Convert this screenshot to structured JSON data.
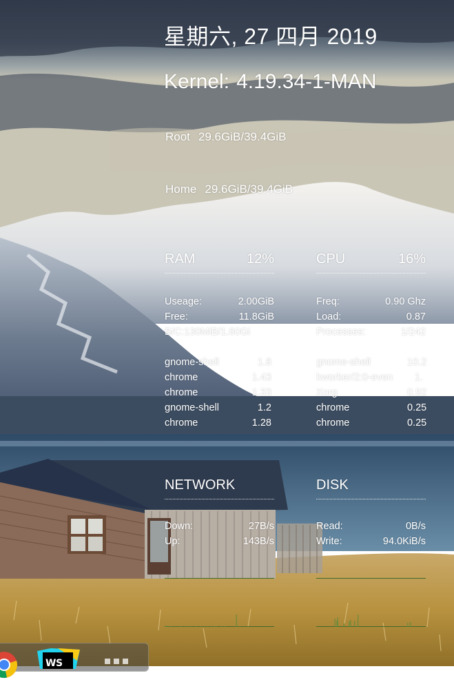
{
  "date": "星期六, 27 四月 2019",
  "kernel": {
    "label": "Kernel:",
    "version": "4.19.34-1-MAN"
  },
  "filesystems": {
    "root": {
      "label": "Root",
      "value": "29.6GiB/39.4GiB"
    },
    "home": {
      "label": "Home",
      "value": "29.6GiB/39.4GiB"
    }
  },
  "ram": {
    "title": "RAM",
    "percent": "12%",
    "stats": [
      {
        "key": "Useage:",
        "value": "2.00GiB"
      },
      {
        "key": "Free:",
        "value": "11.8GiB"
      },
      {
        "key": "B/C:130MiB/1.60Gi",
        "value": ""
      }
    ],
    "processes": [
      {
        "name": "gnome-shell",
        "value": "1.8"
      },
      {
        "name": "chrome",
        "value": "1.43"
      },
      {
        "name": "chrome",
        "value": "1.33"
      },
      {
        "name": "gnome-shell",
        "value": "1.2"
      },
      {
        "name": "chrome",
        "value": "1.28"
      }
    ]
  },
  "cpu": {
    "title": "CPU",
    "percent": "16%",
    "stats": [
      {
        "key": "Freq:",
        "value": "0.90 Ghz"
      },
      {
        "key": "Load:",
        "value": "0.87"
      },
      {
        "key": "Processes:",
        "value": "1/242"
      }
    ],
    "processes": [
      {
        "name": "gnome-shell",
        "value": "10.2"
      },
      {
        "name": "kworker/2:0-even",
        "value": "1."
      },
      {
        "name": "Xorg",
        "value": "0.92"
      },
      {
        "name": "chrome",
        "value": "0.25"
      },
      {
        "name": "chrome",
        "value": "0.25"
      }
    ]
  },
  "network": {
    "title": "NETWORK",
    "stats": [
      {
        "key": "Down:",
        "value": "27B/s"
      },
      {
        "key": "Up:",
        "value": "143B/s"
      }
    ]
  },
  "disk": {
    "title": "DISK",
    "stats": [
      {
        "key": "Read:",
        "value": "0B/s"
      },
      {
        "key": "Write:",
        "value": "94.0KiB/s"
      }
    ]
  },
  "graphs": {
    "net_down": [
      0,
      0,
      1,
      0,
      0,
      0,
      1,
      0,
      0,
      0,
      0,
      0,
      0,
      0,
      0,
      0,
      0,
      0,
      0,
      0,
      0,
      1,
      0,
      0,
      0,
      0,
      0,
      0,
      0,
      0,
      0,
      0,
      0,
      0,
      0,
      0,
      0,
      0,
      0,
      0,
      0,
      0,
      0,
      0,
      0,
      0,
      0,
      0,
      0,
      0,
      0,
      0,
      0,
      0,
      0,
      0,
      0,
      0,
      0,
      0,
      0,
      0,
      0,
      0,
      0,
      0,
      0,
      0,
      0,
      0,
      0,
      0,
      0,
      0,
      0,
      0,
      0,
      0,
      0,
      0,
      0,
      0,
      0,
      0,
      0,
      0,
      0,
      0,
      0,
      0,
      0,
      0,
      0,
      0,
      0,
      0,
      0,
      0,
      0,
      0,
      0,
      0,
      0,
      0,
      0,
      0,
      0,
      0,
      0,
      0,
      0,
      0,
      0,
      0,
      0,
      0,
      0,
      0,
      0,
      0,
      0,
      0,
      0,
      0,
      0,
      0,
      0,
      0,
      0,
      0,
      0,
      0,
      0,
      0,
      0,
      0,
      0,
      0,
      0,
      0,
      0,
      0,
      0,
      0,
      0,
      0,
      0,
      0,
      0,
      0,
      0,
      0,
      0,
      0,
      0,
      0,
      0,
      0,
      0
    ],
    "net_up": [
      0,
      1,
      2,
      1,
      0,
      0,
      1,
      0,
      1,
      0,
      0,
      1,
      0,
      0,
      0,
      0,
      1,
      0,
      0,
      0,
      0,
      1,
      0,
      0,
      1,
      0,
      0,
      0,
      0,
      0,
      1,
      0,
      0,
      0,
      1,
      0,
      0,
      0,
      0,
      1,
      0,
      0,
      0,
      0,
      0,
      0,
      1,
      0,
      0,
      0,
      0,
      0,
      0,
      1,
      0,
      0,
      0,
      0,
      1,
      0,
      0,
      0,
      0,
      1,
      0,
      0,
      0,
      0,
      1,
      0,
      0,
      0,
      0,
      1,
      0,
      1,
      0,
      0,
      0,
      0,
      0,
      0,
      0,
      0,
      1,
      0,
      0,
      0,
      1,
      0,
      0,
      0,
      0,
      0,
      0,
      0,
      0,
      0,
      0,
      0,
      0,
      0,
      0,
      0,
      0,
      18,
      0,
      0,
      0,
      0,
      1,
      0,
      0,
      0,
      0,
      0,
      0,
      0,
      0,
      0,
      0,
      0,
      0,
      0,
      0,
      0,
      0,
      0,
      0,
      0,
      0,
      0,
      0,
      0,
      0,
      0,
      0,
      0,
      0,
      0,
      0,
      0,
      0,
      0,
      0,
      0,
      0,
      0,
      0,
      0,
      0,
      0,
      0,
      0,
      0,
      0,
      0,
      0,
      0,
      0,
      0
    ],
    "disk_read": [
      0,
      0,
      0,
      0,
      0,
      0,
      0,
      0,
      0,
      0,
      0,
      0,
      0,
      0,
      0,
      0,
      0,
      0,
      0,
      0,
      0,
      0,
      0,
      0,
      0,
      0,
      0,
      0,
      0,
      0,
      0,
      0,
      0,
      0,
      0,
      0,
      0,
      0,
      0,
      0,
      0,
      0,
      0,
      0,
      0,
      0,
      0,
      0,
      0,
      0,
      0,
      0,
      0,
      0,
      0,
      0,
      0,
      0,
      0,
      0,
      0,
      0,
      0,
      0,
      0,
      0,
      0,
      0,
      0,
      0,
      0,
      0,
      0,
      0,
      0,
      0,
      0,
      0,
      0,
      0,
      0,
      0,
      0,
      0,
      0,
      0,
      0,
      0,
      0,
      0,
      0,
      0,
      0,
      0,
      0,
      0,
      0,
      0,
      0,
      0,
      0,
      0,
      0,
      0,
      0,
      0,
      0,
      0,
      0,
      0,
      0,
      0,
      0,
      0,
      0,
      0,
      0,
      0,
      0,
      0,
      0,
      0,
      0,
      0,
      0,
      0,
      0,
      0,
      0,
      0,
      0,
      0,
      0,
      0,
      0,
      0,
      0,
      0,
      0,
      0,
      0,
      0,
      0,
      0,
      0,
      0,
      0,
      0,
      0,
      0,
      0,
      0,
      0,
      0,
      0,
      0,
      0,
      0,
      0
    ],
    "disk_write": [
      0,
      0,
      0,
      0,
      0,
      0,
      0,
      0,
      0,
      0,
      0,
      0,
      0,
      0,
      0,
      0,
      0,
      0,
      0,
      0,
      0,
      0,
      0,
      0,
      0,
      0,
      0,
      12,
      0,
      0,
      9,
      14,
      0,
      0,
      0,
      0,
      0,
      0,
      0,
      0,
      5,
      0,
      0,
      0,
      0,
      0,
      0,
      0,
      8,
      0,
      10,
      0,
      0,
      0,
      0,
      0,
      9,
      0,
      0,
      0,
      0,
      18,
      0,
      0,
      0,
      0,
      0,
      0,
      0,
      0,
      0,
      0,
      0,
      0,
      0,
      0,
      0,
      0,
      0,
      0,
      0,
      0,
      0,
      0,
      0,
      0,
      0,
      0,
      0,
      0,
      0,
      0,
      0,
      0,
      0,
      0,
      0,
      0,
      0,
      0,
      0,
      0,
      0,
      0,
      0,
      0,
      0,
      0,
      0,
      0,
      0,
      0,
      0,
      0,
      0,
      0,
      0,
      0,
      0,
      0,
      0,
      0,
      0,
      0,
      0,
      0,
      0,
      0,
      0,
      0,
      0,
      0,
      0,
      0,
      6,
      0,
      0,
      0,
      7,
      0,
      0,
      0,
      0,
      0,
      0,
      0,
      0,
      0,
      0,
      0,
      0,
      0,
      0,
      0,
      0,
      0,
      0,
      0,
      0,
      0,
      0
    ],
    "graph_color": "#5a8a3a",
    "grid_color": "#3f6b2a"
  },
  "dock": {
    "icons": [
      "chrome-icon",
      "webstorm-icon",
      "show-apps-icon"
    ],
    "webstorm_label": "WS"
  }
}
